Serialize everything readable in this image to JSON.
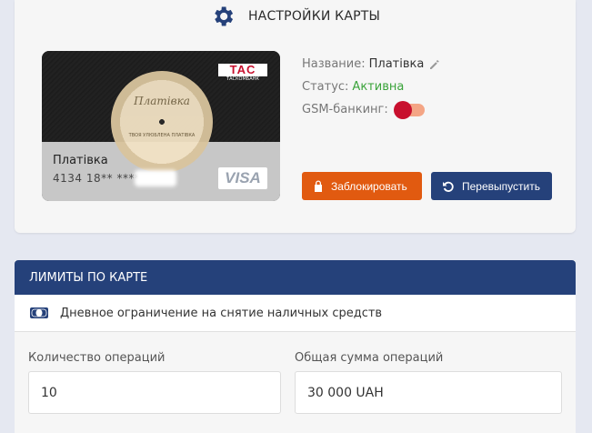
{
  "card_settings": {
    "title": "НАСТРОЙКИ КАРТЫ",
    "icon": "gear-icon"
  },
  "card": {
    "bank_logo": "TAC",
    "bank_logo_sub": "ТАСКОМБАНК",
    "vinyl_title": "Платівка",
    "vinyl_subtitle": "ТВОЯ УЛЮБЛЕНА ПЛАТІВКА",
    "name": "Платівка",
    "number": "4134 18** ****",
    "network": "VISA"
  },
  "info": {
    "name_label": "Название:",
    "name_value": "Платівка",
    "status_label": "Статус:",
    "status_value": "Активна",
    "gsm_label": "GSM-банкинг:",
    "gsm_enabled": true
  },
  "buttons": {
    "block_label": "Заблокировать",
    "reissue_label": "Перевыпустить"
  },
  "limits": {
    "title": "ЛИМИТЫ ПО КАРТЕ",
    "row_label": "Дневное ограничение на снятие наличных средств",
    "count_label": "Количество операций",
    "count_value": "10",
    "sum_label": "Общая сумма операций",
    "sum_value": "30 000 UAH"
  },
  "colors": {
    "primary": "#25417a",
    "accent_orange": "#e15a10",
    "status_green": "#3aa33a",
    "brand_red": "#c8102e"
  }
}
